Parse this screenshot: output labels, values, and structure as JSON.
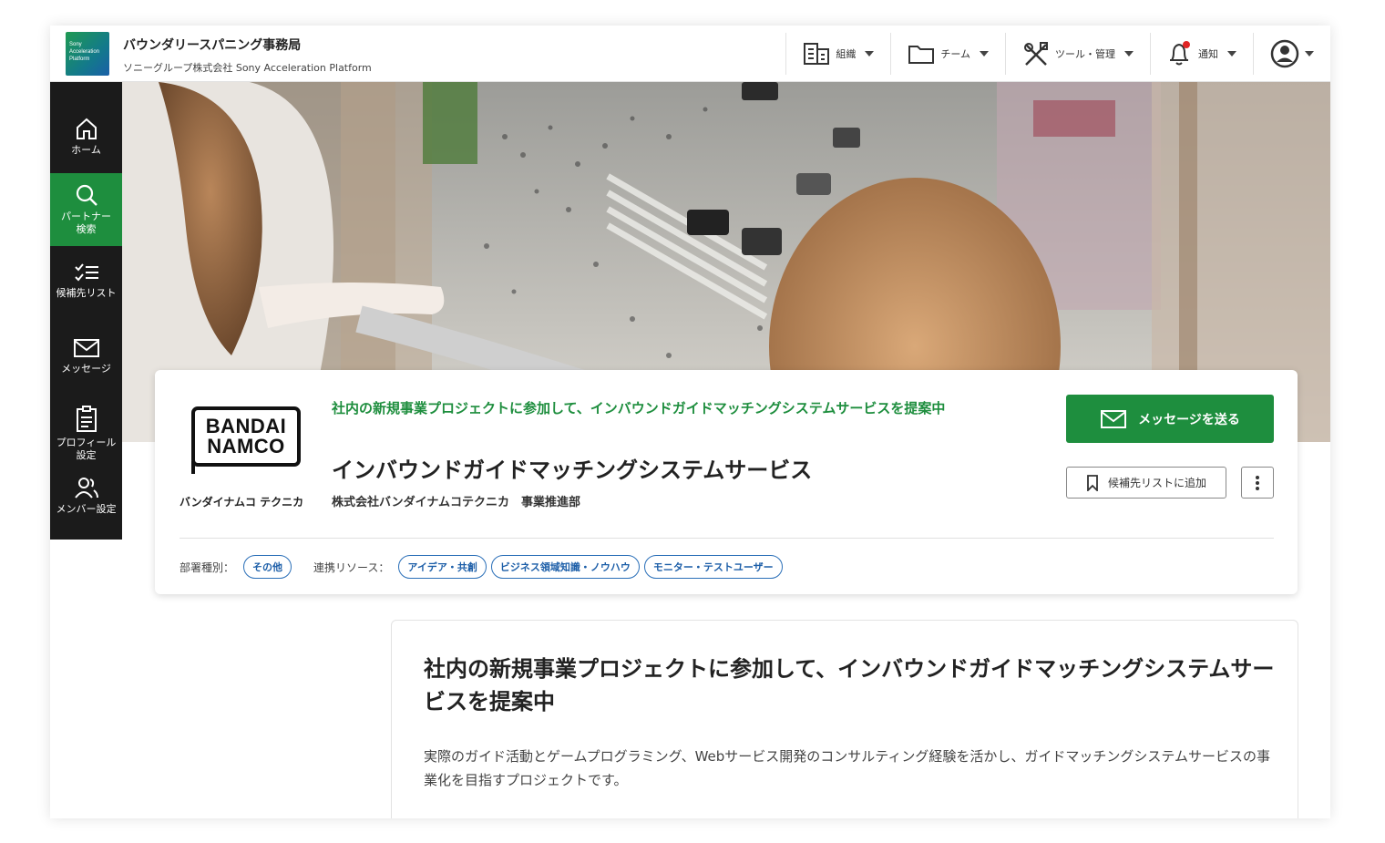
{
  "header": {
    "logo_text": "Sony Acceleration Platform",
    "org_name": "バウンダリースパニング事務局",
    "org_sub": "ソニーグループ株式会社 Sony Acceleration Platform",
    "menu": [
      {
        "label": "組織",
        "icon": "building-icon"
      },
      {
        "label": "チーム",
        "icon": "folder-icon"
      },
      {
        "label": "ツール・管理",
        "icon": "tools-icon"
      },
      {
        "label": "通知",
        "icon": "bell-icon"
      }
    ],
    "notification_dot_color": "#e02424"
  },
  "sidebar": {
    "items": [
      {
        "label": "ホーム",
        "icon": "home-icon"
      },
      {
        "label": "パートナー検索",
        "icon": "search-icon",
        "active": true
      },
      {
        "label": "候補先リスト",
        "icon": "checklist-icon"
      },
      {
        "label": "メッセージ",
        "icon": "mail-icon"
      },
      {
        "label": "プロフィール設定",
        "icon": "profile-form-icon"
      },
      {
        "label": "メンバー設定",
        "icon": "members-icon"
      }
    ]
  },
  "profile": {
    "brand_line1": "BANDAI",
    "brand_line2": "NAMCO",
    "company_short": "バンダイナムコ テクニカ",
    "headline": "社内の新規事業プロジェクトに参加して、インバウンドガイドマッチングシステムサービスを提案中",
    "title": "インバウンドガイドマッチングシステムサービス",
    "company_dept": "株式会社バンダイナムコテクニカ　事業推進部",
    "send_message_label": "メッセージを送る",
    "add_candidate_label": "候補先リストに追加",
    "department_type_label": "部署種別：",
    "department_type": "その他",
    "resources_label": "連携リソース：",
    "resources": [
      "アイデア・共創",
      "ビジネス領域知識・ノウハウ",
      "モニター・テストユーザー"
    ]
  },
  "detail": {
    "title": "社内の新規事業プロジェクトに参加して、インバウンドガイドマッチングシステムサービスを提案中",
    "body": "実際のガイド活動とゲームプログラミング、Webサービス開発のコンサルティング経験を活かし、ガイドマッチングシステムサービスの事業化を目指すプロジェクトです。"
  },
  "colors": {
    "accent_green": "#1e8e3e",
    "tag_blue": "#1c5ea8",
    "sidebar_bg": "#1b1b1b"
  }
}
